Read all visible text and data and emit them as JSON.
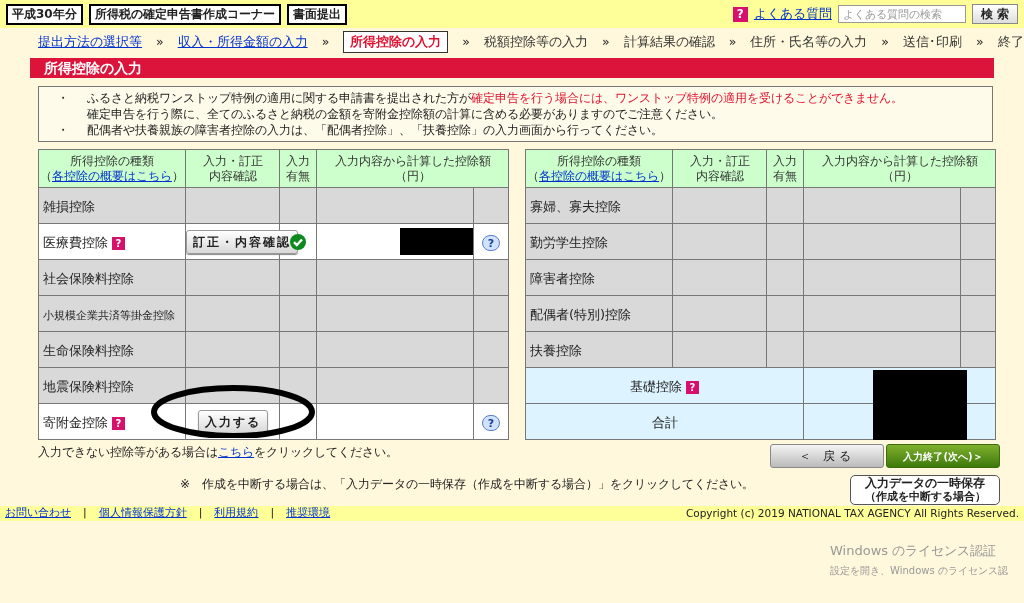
{
  "header": {
    "year_badge": "平成30年分",
    "corner_title": "所得税の確定申告書作成コーナー",
    "submit_label": "書面提出",
    "faq_mark": "?",
    "faq_link": "よくある質問",
    "search": {
      "placeholder": "よくある質問の検索"
    },
    "search_button": "検 索"
  },
  "steps": [
    {
      "label": "提出方法の選択等",
      "link": true,
      "selected": false,
      "separator": "»"
    },
    {
      "label": "収入・所得金額の入力",
      "link": true,
      "selected": false,
      "separator": "»"
    },
    {
      "label": "所得控除の入力",
      "link": false,
      "selected": true,
      "separator": "»"
    },
    {
      "label": "税額控除等の入力",
      "link": false,
      "selected": false,
      "separator": "»"
    },
    {
      "label": "計算結果の確認",
      "link": false,
      "selected": false,
      "separator": "»"
    },
    {
      "label": "住所・氏名等の入力",
      "link": false,
      "selected": false,
      "separator": "»"
    },
    {
      "label": "送信･印刷",
      "link": false,
      "selected": false,
      "separator": "»"
    },
    {
      "label": "終了",
      "link": false,
      "selected": false
    }
  ],
  "page_title": "所得控除の入力",
  "notices": [
    {
      "bullet": "・",
      "parts": [
        {
          "text": "ふるさと納税ワンストップ特例の適用に関する申請書を提出された方が",
          "warning": false
        },
        {
          "text": "確定申告を行う場合には、ワンストップ特例の適用を受けることができません。",
          "warning": true
        }
      ]
    },
    {
      "parts": [
        {
          "text": "確定申告を行う際に、全てのふるさと納税の金額を寄附金控除額の計算に含める必要がありますのでご注意ください。",
          "warning": false
        }
      ]
    },
    {
      "bullet": "・",
      "parts": [
        {
          "text": "配偶者や扶養親族の障害者控除の入力は、「配偶者控除」、「扶養控除」の入力画面から行ってください。",
          "warning": false
        }
      ]
    }
  ],
  "tables": [
    {
      "columns": [
        {
          "lines": [
            "所得控除の種類"
          ],
          "link": {
            "open": "（",
            "label": "各控除の概要はこちら",
            "close": "）"
          }
        },
        {
          "lines": [
            "入力・訂正",
            "内容確認"
          ]
        },
        {
          "lines": [
            "入力",
            "有無"
          ]
        },
        {
          "lines": [
            "入力内容から計算した控除額（円）"
          ]
        }
      ],
      "rows": [
        {
          "name": "雑損控除",
          "disabled": true,
          "entered": false
        },
        {
          "name": "医療費控除",
          "help": "?",
          "disabled": false,
          "action": "訂正・内容確認",
          "entered": true,
          "redacted": true,
          "info": "?"
        },
        {
          "name": "社会保険料控除",
          "disabled": true,
          "entered": false
        },
        {
          "name": "小規模企業共済等掛金控除",
          "disabled": true,
          "entered": false,
          "small": true
        },
        {
          "name": "生命保険料控除",
          "disabled": true,
          "entered": false
        },
        {
          "name": "地震保険料控除",
          "disabled": true,
          "entered": false
        },
        {
          "name": "寄附金控除",
          "help": "?",
          "disabled": false,
          "action": "入力する",
          "entered": false,
          "info": "?"
        }
      ]
    },
    {
      "columns": [
        {
          "lines": [
            "所得控除の種類"
          ],
          "link": {
            "open": "（",
            "label": "各控除の概要はこちら",
            "close": "）"
          }
        },
        {
          "lines": [
            "入力・訂正",
            "内容確認"
          ]
        },
        {
          "lines": [
            "入力",
            "有無"
          ]
        },
        {
          "lines": [
            "入力内容から計算した控除額（円）"
          ]
        }
      ],
      "rows": [
        {
          "name": "寡婦、寡夫控除",
          "disabled": true,
          "entered": false
        },
        {
          "name": "勤労学生控除",
          "disabled": true,
          "entered": false
        },
        {
          "name": "障害者控除",
          "disabled": true,
          "entered": false
        },
        {
          "name": "配偶者(特別)控除",
          "disabled": true,
          "entered": false
        },
        {
          "name": "扶養控除",
          "disabled": true,
          "entered": false
        }
      ],
      "summary": [
        {
          "name": "基礎控除",
          "help": "?"
        },
        {
          "name": "合計"
        }
      ]
    }
  ],
  "other_note": {
    "text": "入力できない控除等がある場合は",
    "link": "こちら",
    "suffix": "をクリックしてください。"
  },
  "back_button": "＜ 戻る",
  "next_button": "入力終了(次へ)＞",
  "save_note": "※　作成を中断する場合は、「入力データの一時保存（作成を中断する場合）」をクリックしてください。",
  "save_button": {
    "title": "入力データの一時保存",
    "subtitle": "（作成を中断する場合）"
  },
  "footer": {
    "links": [
      {
        "label": "お問い合わせ",
        "separator": "|"
      },
      {
        "label": "個人情報保護方針",
        "separator": "|"
      },
      {
        "label": "利用規約",
        "separator": "|"
      },
      {
        "label": "推奨環境"
      }
    ],
    "copyright": "Copyright (c) 2019 NATIONAL TAX AGENCY All Rights Reserved."
  },
  "activation": {
    "title": "Windows のライセンス認証",
    "subtitle": "設定を開き、Windows のライセンス認"
  }
}
